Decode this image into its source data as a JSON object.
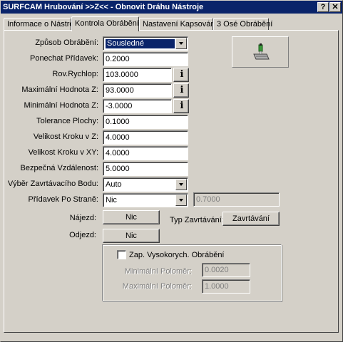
{
  "window": {
    "title": "SURFCAM Hrubování >>Z<< - Obnovit Dráhu Nástroje",
    "help_btn": "?",
    "close_btn": "✕"
  },
  "tabs": [
    {
      "label": "Informace o Nástroji"
    },
    {
      "label": "Kontrola Obrábění",
      "active": true
    },
    {
      "label": "Nastavení Kapsování"
    },
    {
      "label": "3 Osé Obrábění"
    }
  ],
  "form": {
    "zpusob": {
      "label": "Způsob Obrábění:",
      "value": "Sousledné"
    },
    "pridavek": {
      "label": "Ponechat Přídavek:",
      "value": "0.2000"
    },
    "rovrychlop": {
      "label": "Rov.Rychlop:",
      "value": "103.0000"
    },
    "max_z": {
      "label": "Maximální Hodnota Z:",
      "value": "93.0000"
    },
    "min_z": {
      "label": "Minimální Hodnota Z:",
      "value": "-3.0000"
    },
    "tolerance": {
      "label": "Tolerance Plochy:",
      "value": "0.1000"
    },
    "krok_z": {
      "label": "Velikost Kroku v Z:",
      "value": "4.0000"
    },
    "krok_xy": {
      "label": "Velikost Kroku v XY:",
      "value": "4.0000"
    },
    "bezpecna": {
      "label": "Bezpečná Vzdálenost:",
      "value": "5.0000"
    },
    "zavrt_bod": {
      "label": "Výběr Zavrtávacího Bodu:",
      "value": "Auto"
    },
    "pridavek_strane": {
      "label": "Přídavek Po Straně:",
      "value": "Nic",
      "extra_value": "0.7000"
    }
  },
  "najezd": {
    "label": "Nájezd:",
    "button": "Nic"
  },
  "odjezd": {
    "label": "Odjezd:",
    "button": "Nic"
  },
  "typ_zavrt": {
    "label": "Typ Zavrtávání:",
    "button": "Zavrtávání"
  },
  "hsm": {
    "checkbox_label": "Zap. Vysokorych. Obrábění",
    "checked": false,
    "min_polomer": {
      "label": "Minimální Poloměr:",
      "value": "0.0020"
    },
    "max_polomer": {
      "label": "Maximální Poloměr:",
      "value": "1.0000"
    }
  },
  "info_button_icon": "info-icon",
  "tool_icon": "tool-preview-icon",
  "colors": {
    "titlebar": "#0a246a",
    "face": "#d4d0c8",
    "selection": "#0a246a"
  }
}
